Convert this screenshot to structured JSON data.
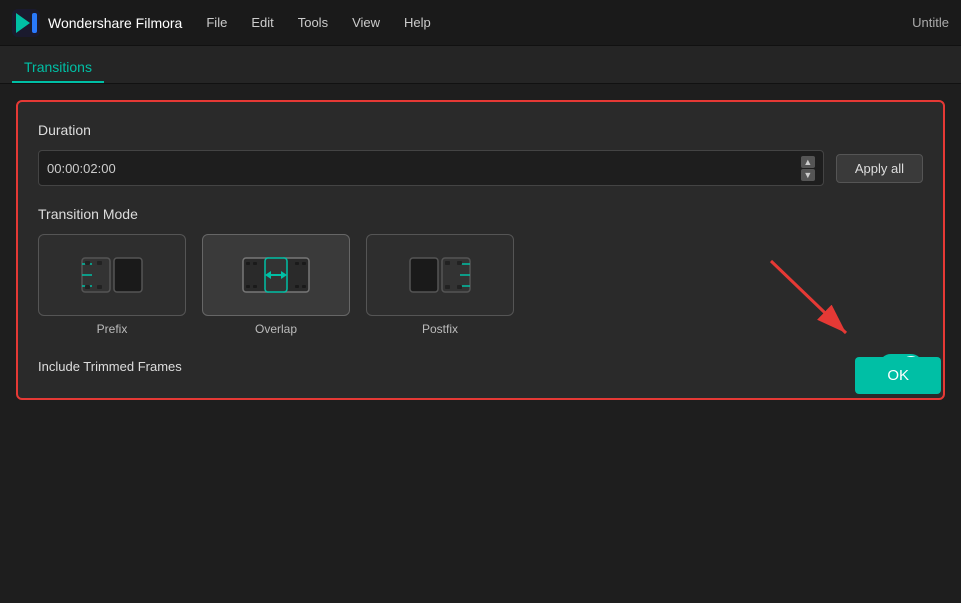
{
  "app": {
    "name": "Wondershare Filmora",
    "title": "Untitle"
  },
  "menu": {
    "items": [
      "File",
      "Edit",
      "Tools",
      "View",
      "Help"
    ]
  },
  "tabs": {
    "active": "Transitions"
  },
  "settings": {
    "duration_label": "Duration",
    "duration_value": "00:00:02:00",
    "apply_all_label": "Apply all",
    "transition_mode_label": "Transition Mode",
    "modes": [
      {
        "id": "prefix",
        "label": "Prefix",
        "selected": false
      },
      {
        "id": "overlap",
        "label": "Overlap",
        "selected": true
      },
      {
        "id": "postfix",
        "label": "Postfix",
        "selected": false
      }
    ],
    "include_trimmed_label": "Include Trimmed Frames",
    "toggle_on": true
  },
  "footer": {
    "ok_label": "OK"
  }
}
